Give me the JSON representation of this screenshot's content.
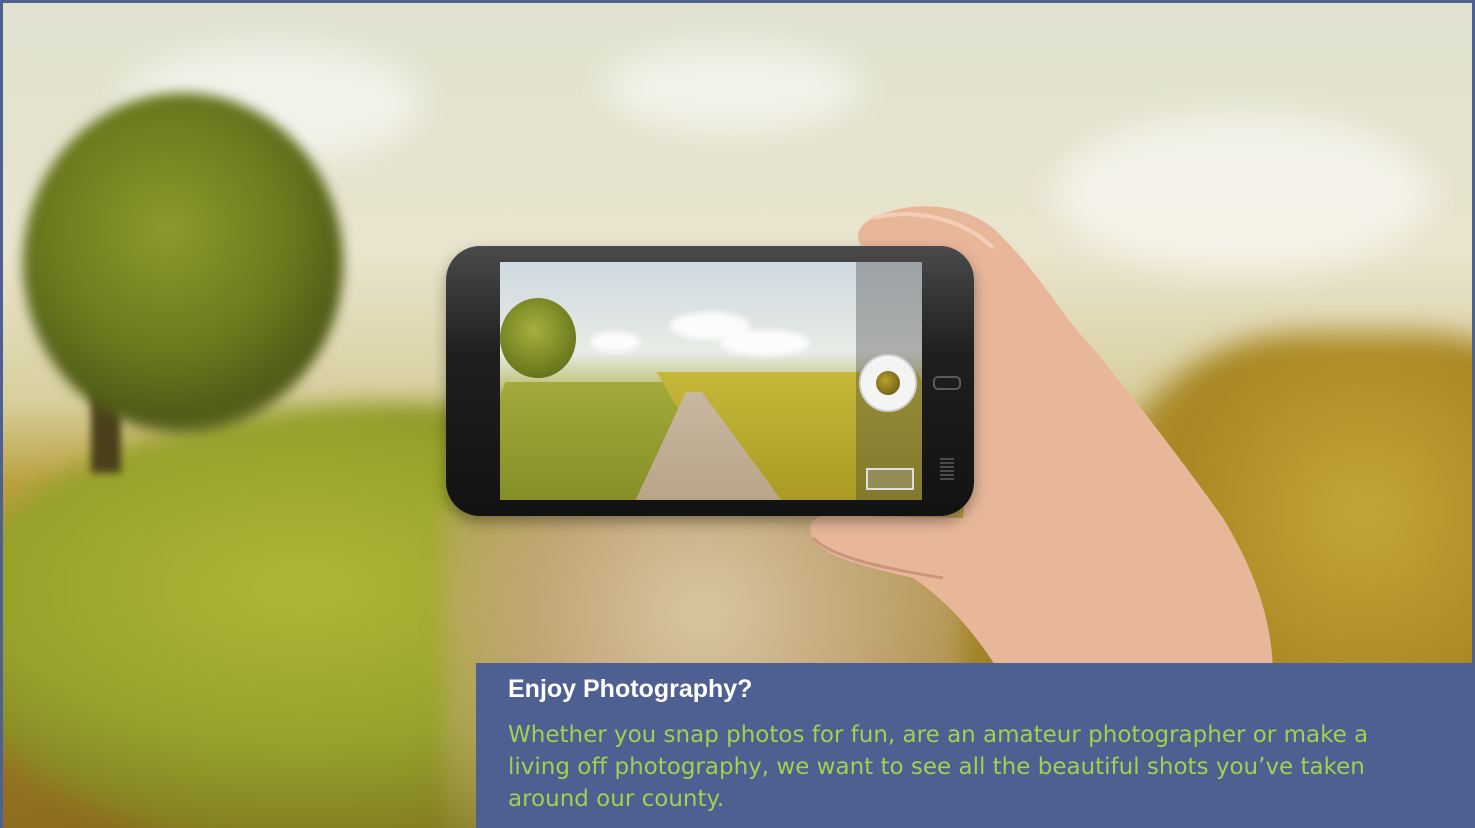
{
  "caption": {
    "title": "Enjoy Photography?",
    "body": "Whether you snap photos for fun, are an amateur photographer or make a living off photography, we want to see all the beautiful shots you’ve taken around our county."
  },
  "colors": {
    "panel_background": "#4e5f92",
    "title_text": "#ffffff",
    "body_text": "#9fd24e"
  }
}
